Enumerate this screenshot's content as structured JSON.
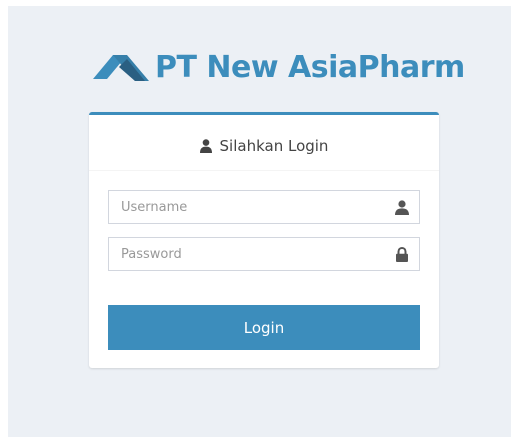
{
  "brand": {
    "name": "PT New AsiaPharm",
    "logo_icon": "pharmacy-chevron-logo",
    "color": "#3c8dbc"
  },
  "login_box": {
    "title": "Silahkan Login",
    "title_icon": "user-icon",
    "username": {
      "placeholder": "Username",
      "value": "",
      "icon": "user-icon"
    },
    "password": {
      "placeholder": "Password",
      "value": "",
      "icon": "lock-icon"
    },
    "submit_label": "Login",
    "accent_color": "#3c8dbc",
    "background_color": "#ecf0f5"
  }
}
